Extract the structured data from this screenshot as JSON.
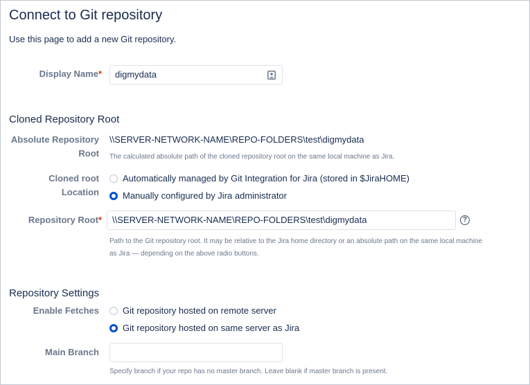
{
  "page": {
    "title": "Connect to Git repository",
    "intro": "Use this page to add a new Git repository."
  },
  "display_name": {
    "label": "Display Name",
    "required_marker": "*",
    "value": "digmydata"
  },
  "cloned_root": {
    "section_title": "Cloned Repository Root",
    "absolute_label_line1": "Absolute Repository",
    "absolute_label_line2": "Root",
    "absolute_value": "\\\\SERVER-NETWORK-NAME\\REPO-FOLDERS\\test\\digmydata",
    "absolute_desc": "The calculated absolute path of the cloned repository root on the same local machine as Jira.",
    "location_label_line1": "Cloned root",
    "location_label_line2": "Location",
    "option_auto": "Automatically managed by Git Integration for Jira (stored in $JiraHOME)",
    "option_manual": "Manually configured by Jira administrator",
    "selected": "manual",
    "repo_root_label": "Repository Root",
    "required_marker": "*",
    "repo_root_value": "\\\\SERVER-NETWORK-NAME\\REPO-FOLDERS\\test\\digmydata",
    "repo_root_desc_line1": "Path to the Git repository root. It may be relative to the Jira home directory or an absolute path on the same local machine",
    "repo_root_desc_line2": "as Jira — depending on the above radio buttons."
  },
  "repo_settings": {
    "section_title": "Repository Settings",
    "fetches_label": "Enable Fetches",
    "option_remote": "Git repository hosted on remote server",
    "option_same": "Git repository hosted on same server as Jira",
    "selected": "same",
    "main_branch_label": "Main Branch",
    "main_branch_value": "",
    "main_branch_desc": "Specify branch if your repo has no master branch. Leave blank if master branch is present."
  },
  "icons": {
    "help": "question-circle-icon",
    "contact": "contact-card-icon"
  }
}
